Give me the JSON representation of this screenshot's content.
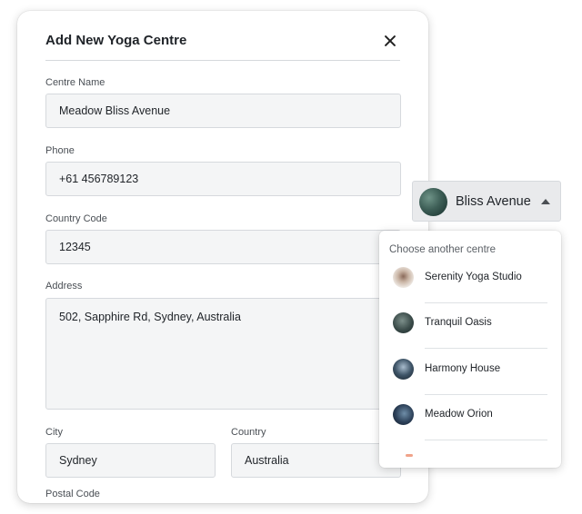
{
  "modal": {
    "title": "Add New Yoga Centre",
    "fields": {
      "centre_name": {
        "label": "Centre Name",
        "value": "Meadow Bliss Avenue"
      },
      "phone": {
        "label": "Phone",
        "value": "+61 456789123"
      },
      "country_code": {
        "label": "Country Code",
        "value": "12345"
      },
      "address": {
        "label": "Address",
        "value": "502, Sapphire Rd, Sydney, Australia"
      },
      "city": {
        "label": "City",
        "value": "Sydney"
      },
      "country": {
        "label": "Country",
        "value": "Australia"
      },
      "postal_code": {
        "label": "Postal Code"
      }
    }
  },
  "centre_selector": {
    "selected": "Bliss Avenue",
    "dropdown": {
      "heading": "Choose another centre",
      "options": [
        {
          "label": "Serenity Yoga Studio"
        },
        {
          "label": "Tranquil Oasis"
        },
        {
          "label": "Harmony House"
        },
        {
          "label": "Meadow Orion"
        }
      ]
    }
  }
}
